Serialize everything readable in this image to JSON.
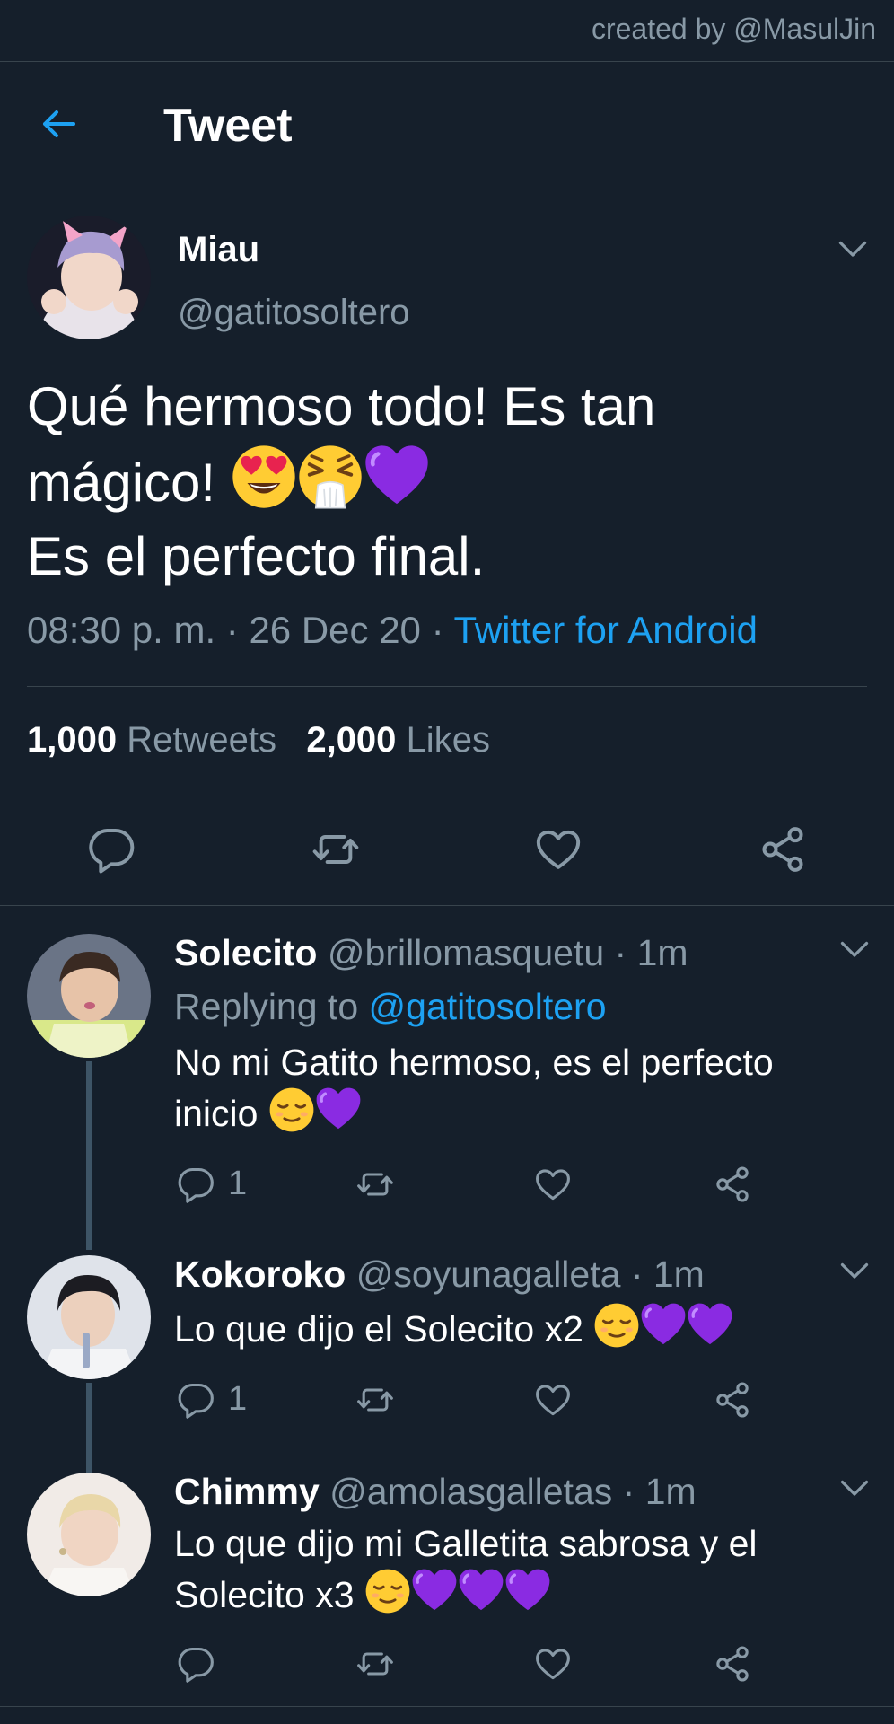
{
  "credit": "created by @MasulJin",
  "header": {
    "title": "Tweet"
  },
  "tweet": {
    "name": "Miau",
    "handle": "@gatitosoltero",
    "text_line1": "Qué hermoso todo! Es tan",
    "text_line2": "mágico!",
    "text_line3": "Es el perfecto final.",
    "text_emojis": [
      "heart-eyes-emoji",
      "sneezing-emoji",
      "purple-heart-emoji"
    ],
    "time": "08:30 p. m.",
    "date": "26 Dec 20",
    "source": "Twitter for Android",
    "retweets_count": "1,000",
    "retweets_label": "Retweets",
    "likes_count": "2,000",
    "likes_label": "Likes"
  },
  "replies": [
    {
      "name": "Solecito",
      "handle": "@brillomasquetu",
      "time": "1m",
      "replying_label": "Replying to",
      "replying_to": "@gatitosoltero",
      "text_line1": "No mi Gatito hermoso, es el perfecto",
      "text_line2": "inicio",
      "emojis": [
        "relieved-emoji",
        "purple-heart-emoji"
      ],
      "reply_count": "1"
    },
    {
      "name": "Kokoroko",
      "handle": "@soyunagalleta",
      "time": "1m",
      "text_line1": "Lo que dijo el Solecito x2",
      "emojis": [
        "relieved-emoji",
        "purple-heart-emoji",
        "purple-heart-emoji"
      ],
      "reply_count": "1"
    },
    {
      "name": "Chimmy",
      "handle": "@amolasgalletas",
      "time": "1m",
      "text_line1": "Lo que dijo mi Galletita sabrosa y el",
      "text_line2": "Solecito x3",
      "emojis": [
        "relieved-emoji",
        "purple-heart-emoji",
        "purple-heart-emoji",
        "purple-heart-emoji"
      ],
      "reply_count": ""
    }
  ],
  "colors": {
    "background": "#151f2b",
    "accent": "#1da1f2",
    "muted": "#8899a6",
    "divider": "#38444d",
    "thread_line": "#3d5466"
  }
}
